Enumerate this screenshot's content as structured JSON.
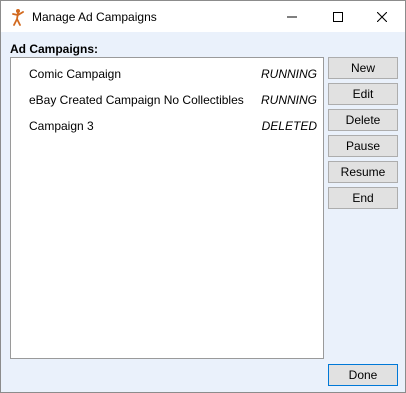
{
  "window": {
    "title": "Manage Ad Campaigns",
    "icon": "app-figure-icon",
    "controls": {
      "minimize": "minimize-icon",
      "maximize": "maximize-icon",
      "close": "close-icon"
    }
  },
  "campaigns": {
    "label": "Ad Campaigns:",
    "items": [
      {
        "name": "Comic Campaign",
        "status": "RUNNING"
      },
      {
        "name": "eBay Created Campaign No Collectibles",
        "status": "RUNNING"
      },
      {
        "name": "Campaign 3",
        "status": "DELETED"
      }
    ]
  },
  "actions": {
    "new": "New",
    "edit": "Edit",
    "delete": "Delete",
    "pause": "Pause",
    "resume": "Resume",
    "end": "End",
    "done": "Done"
  },
  "colors": {
    "window_bg": "#eaf1fb",
    "titlebar_bg": "#ffffff",
    "button_bg": "#e1e1e1",
    "default_button_border": "#0078d7",
    "app_icon": "#d2691e"
  }
}
